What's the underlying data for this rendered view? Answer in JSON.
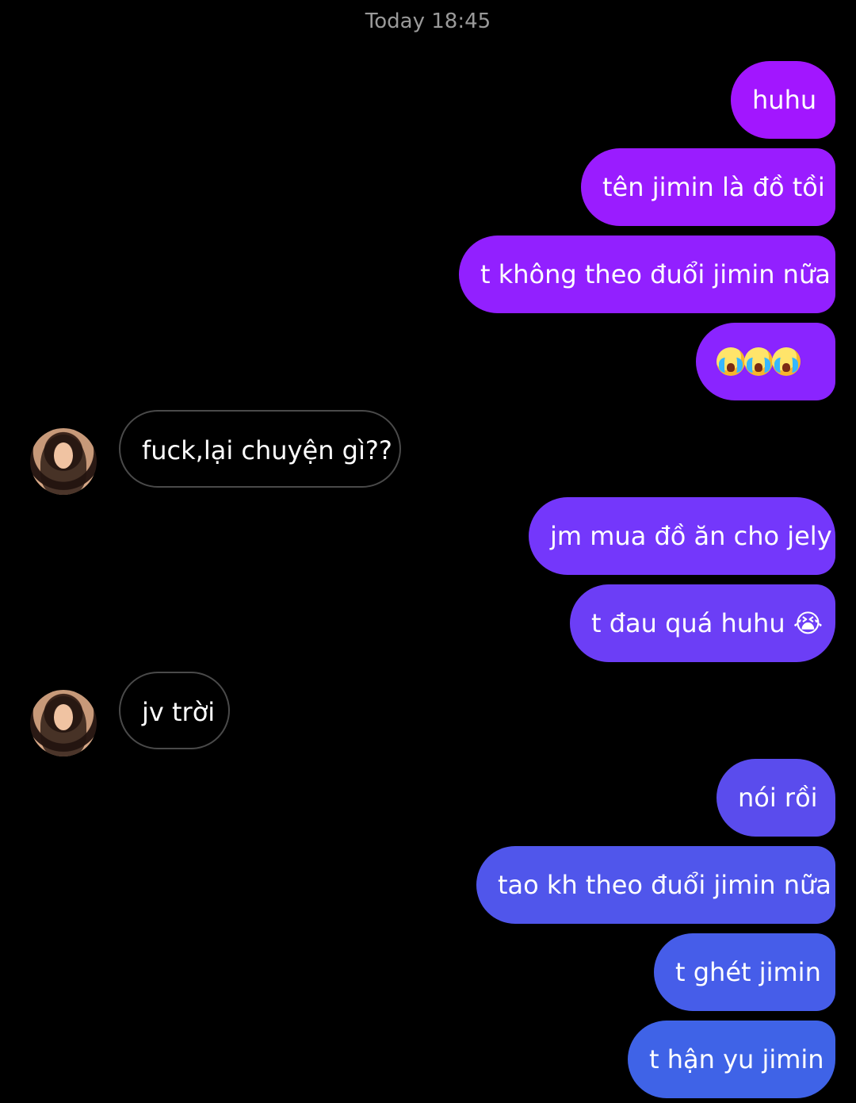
{
  "chat": {
    "timestamp": "Today 18:45",
    "messages": [
      {
        "sender": "me",
        "text": "huhu"
      },
      {
        "sender": "me",
        "text": "tên jimin là đồ tồi"
      },
      {
        "sender": "me",
        "text": "t không theo đuổi jimin nữa"
      },
      {
        "sender": "me",
        "text": "😭😭😭"
      },
      {
        "sender": "other",
        "text": "fuck,lại chuyện gì??"
      },
      {
        "sender": "me",
        "text": "jm mua đồ ăn cho jely"
      },
      {
        "sender": "me",
        "text": "t đau quá huhu 😭"
      },
      {
        "sender": "other",
        "text": "jv trời"
      },
      {
        "sender": "me",
        "text": "nói rồi"
      },
      {
        "sender": "me",
        "text": "tao kh theo đuổi jimin nữa"
      },
      {
        "sender": "me",
        "text": "t ghét jimin"
      },
      {
        "sender": "me",
        "text": "t hận yu jimin"
      }
    ]
  },
  "colors": {
    "background": "#000000",
    "timestamp": "#9a9a9a",
    "received_border": "#4a4a4a",
    "sent_gradient_top": "#a11cff",
    "sent_gradient_bottom": "#3e62e8"
  },
  "icons": {
    "emoji": "crying-face-icon",
    "avatar": "contact-avatar"
  }
}
